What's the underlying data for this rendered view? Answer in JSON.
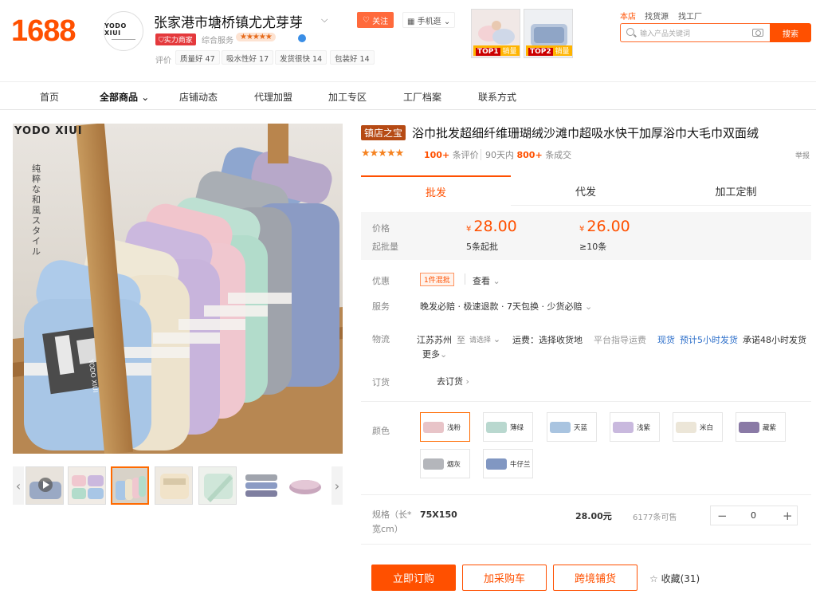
{
  "header": {
    "logo": "1688",
    "shop_logo_text": "YODO XIUI",
    "shop_name": "张家港市塘桥镇尤尤芽芽",
    "strength_badge": "实力商家",
    "service_label": "综合服务",
    "rating_label": "评价",
    "ratings": [
      "质量好 47",
      "吸水性好 17",
      "发货很快 14",
      "包装好 14"
    ],
    "follow": "关注",
    "mobile": "手机逛",
    "top_products": [
      {
        "rank": "TOP1",
        "label": "销量"
      },
      {
        "rank": "TOP2",
        "label": "销量"
      }
    ],
    "scope_links": [
      "本店",
      "找货源",
      "找工厂"
    ],
    "search_placeholder": "输入产品关键词",
    "search_button": "搜索"
  },
  "nav": {
    "items": [
      "首页",
      "全部商品",
      "店铺动态",
      "代理加盟",
      "加工专区",
      "工厂档案",
      "联系方式"
    ]
  },
  "gallery": {
    "brand_text": "YODO XIUI",
    "vertical_text": "纯粹な和風スタイル",
    "label_text": "YODO XIUI"
  },
  "product": {
    "shop_badge": "镇店之宝",
    "title": "浴巾批发超细纤维珊瑚绒沙滩巾超吸水快干加厚浴巾大毛巾双面绒",
    "reviews": "100+",
    "reviews_suffix": "条评价",
    "sold_prefix": "90天内",
    "sold": "800+",
    "sold_suffix": "条成交",
    "report": "举报",
    "tabs": [
      "批发",
      "代发",
      "加工定制"
    ],
    "price_label": "价格",
    "moq_label": "起批量",
    "currency": "¥",
    "tiers": [
      {
        "price": "28.00",
        "qty": "5条起批"
      },
      {
        "price": "26.00",
        "qty": "≥10条"
      }
    ],
    "discount_label": "优惠",
    "discount_tag": "1件混批",
    "discount_view": "查看",
    "service_label": "服务",
    "service_value": "晚发必赔 · 极速退款 · 7天包换 · 少货必赔",
    "logistics_label": "物流",
    "ship_from": "江苏苏州",
    "ship_to_word": "至",
    "ship_to_select": "请选择",
    "freight": "运费：选择收货地",
    "freight_tip": "平台指导运费",
    "stock": "现货",
    "ship_time": "预计5小时发货",
    "promise": "承诺48小时发货",
    "more": "更多",
    "booking_label": "订货",
    "booking_value": "去订货",
    "color_label": "颜色",
    "colors": [
      {
        "name": "浅粉",
        "c": "#e8c4c8"
      },
      {
        "name": "薄绿",
        "c": "#b9d8cf"
      },
      {
        "name": "天蓝",
        "c": "#a9c4e0"
      },
      {
        "name": "浅紫",
        "c": "#c9b9de"
      },
      {
        "name": "米白",
        "c": "#ece6d8"
      },
      {
        "name": "藏紫",
        "c": "#8a7aa6"
      },
      {
        "name": "烟灰",
        "c": "#b4b6bb"
      },
      {
        "name": "牛仔兰",
        "c": "#8197c2"
      }
    ],
    "spec_label": "规格（长*宽cm）",
    "spec": "75X150",
    "spec_price": "28.00元",
    "stock_qty": "6177条可售",
    "quantity": "0",
    "buy_now": "立即订购",
    "add_cart": "加采购车",
    "cross_border": "跨境铺货",
    "favorite": "收藏(31)"
  }
}
